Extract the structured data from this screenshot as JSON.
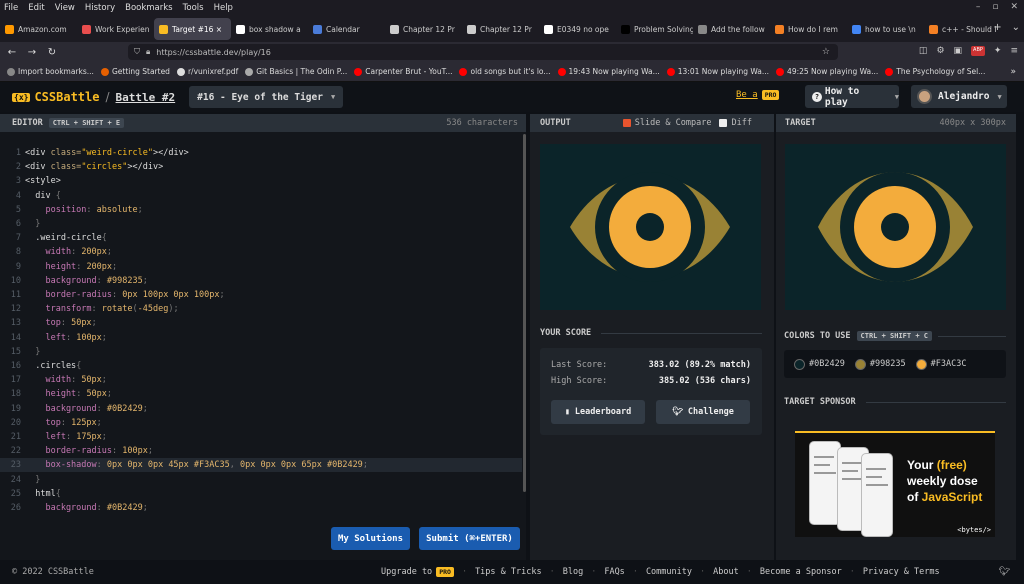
{
  "menubar": {
    "items": [
      "File",
      "Edit",
      "View",
      "History",
      "Bookmarks",
      "Tools",
      "Help"
    ]
  },
  "tabs": [
    {
      "label": "Amazon.com",
      "color": "#ff9900",
      "glyph": "a"
    },
    {
      "label": "Work Experien",
      "color": "#e94e4e",
      "glyph": "W"
    },
    {
      "label": "Target #16 ×",
      "color": "#f9bc23",
      "glyph": "C",
      "active": true
    },
    {
      "label": "box shadow a",
      "color": "#ffffff",
      "glyph": "/"
    },
    {
      "label": "Calendar",
      "color": "#4a7bd8",
      "glyph": "•"
    },
    {
      "label": "Chapter 12 Pr",
      "color": "#cccccc",
      "glyph": "□"
    },
    {
      "label": "Chapter 12 Pr",
      "color": "#cccccc",
      "glyph": "□"
    },
    {
      "label": "E0349 no ope",
      "color": "#ffffff",
      "glyph": "G"
    },
    {
      "label": "Problem Solving",
      "color": "#000000",
      "glyph": "■"
    },
    {
      "label": "Add the follow",
      "color": "#888888",
      "glyph": "◐"
    },
    {
      "label": "How do I rem",
      "color": "#f48024",
      "glyph": "S"
    },
    {
      "label": "how to use \\n",
      "color": "#4285f4",
      "glyph": "G"
    },
    {
      "label": "c++ - Should I",
      "color": "#f48024",
      "glyph": "S"
    }
  ],
  "url": "https://cssbattle.dev/play/16",
  "bookmarks": [
    {
      "label": "Import bookmarks...",
      "color": "#888888"
    },
    {
      "label": "Getting Started",
      "color": "#e66000"
    },
    {
      "label": "r/vunixref.pdf",
      "color": "#dddddd"
    },
    {
      "label": "Git Basics | The Odin P...",
      "color": "#aaaaaa"
    },
    {
      "label": "Carpenter Brut - YouT...",
      "color": "#ff0000"
    },
    {
      "label": "old songs but it's lo...",
      "color": "#ff0000"
    },
    {
      "label": "19:43 Now playing Wa...",
      "color": "#ff0000"
    },
    {
      "label": "13:01 Now playing Wa...",
      "color": "#ff0000"
    },
    {
      "label": "49:25 Now playing Wa...",
      "color": "#ff0000"
    },
    {
      "label": "The Psychology of Sel...",
      "color": "#ff0000"
    }
  ],
  "header": {
    "logo": "CSSBattle",
    "battle": "Battle #2",
    "level": "#16 - Eye of the Tiger",
    "be_a": "Be a",
    "pro": "PRO",
    "how_to_play": "How to play",
    "username": "Alejandro"
  },
  "editor": {
    "title": "EDITOR",
    "shortcut": "CTRL + SHIFT + E",
    "char_count": "536 characters",
    "highlighted_line": 23,
    "lines": [
      [
        [
          "c-tag",
          "<div "
        ],
        [
          "c-attr",
          "class="
        ],
        [
          "c-str",
          "\"weird-circle\""
        ],
        [
          "c-tag",
          "></div>"
        ]
      ],
      [
        [
          "c-tag",
          "<div "
        ],
        [
          "c-attr",
          "class="
        ],
        [
          "c-str",
          "\"circles\""
        ],
        [
          "c-tag",
          "></div>"
        ]
      ],
      [
        [
          "c-tag",
          "<style>"
        ]
      ],
      [
        [
          "c-sel",
          "  div "
        ],
        [
          "c-pun",
          "{"
        ]
      ],
      [
        [
          "c-prop",
          "    position"
        ],
        [
          "c-pun",
          ": "
        ],
        [
          "c-val",
          "absolute"
        ],
        [
          "c-pun",
          ";"
        ]
      ],
      [
        [
          "c-pun",
          "  }"
        ]
      ],
      [
        [
          "c-sel",
          "  .weird-circle"
        ],
        [
          "c-pun",
          "{"
        ]
      ],
      [
        [
          "c-prop",
          "    width"
        ],
        [
          "c-pun",
          ": "
        ],
        [
          "c-val",
          "200px"
        ],
        [
          "c-pun",
          ";"
        ]
      ],
      [
        [
          "c-prop",
          "    height"
        ],
        [
          "c-pun",
          ": "
        ],
        [
          "c-val",
          "200px"
        ],
        [
          "c-pun",
          ";"
        ]
      ],
      [
        [
          "c-prop",
          "    background"
        ],
        [
          "c-pun",
          ": "
        ],
        [
          "c-val",
          "#998235"
        ],
        [
          "c-pun",
          ";"
        ]
      ],
      [
        [
          "c-prop",
          "    border-radius"
        ],
        [
          "c-pun",
          ": "
        ],
        [
          "c-val",
          "0px 100px 0px 100px"
        ],
        [
          "c-pun",
          ";"
        ]
      ],
      [
        [
          "c-prop",
          "    transform"
        ],
        [
          "c-pun",
          ": "
        ],
        [
          "c-val",
          "rotate"
        ],
        [
          "c-pun",
          "("
        ],
        [
          "c-val",
          "-45deg"
        ],
        [
          "c-pun",
          ");"
        ]
      ],
      [
        [
          "c-prop",
          "    top"
        ],
        [
          "c-pun",
          ": "
        ],
        [
          "c-val",
          "50px"
        ],
        [
          "c-pun",
          ";"
        ]
      ],
      [
        [
          "c-prop",
          "    left"
        ],
        [
          "c-pun",
          ": "
        ],
        [
          "c-val",
          "100px"
        ],
        [
          "c-pun",
          ";"
        ]
      ],
      [
        [
          "c-pun",
          "  }"
        ]
      ],
      [
        [
          "c-sel",
          "  .circles"
        ],
        [
          "c-pun",
          "{"
        ]
      ],
      [
        [
          "c-prop",
          "    width"
        ],
        [
          "c-pun",
          ": "
        ],
        [
          "c-val",
          "50px"
        ],
        [
          "c-pun",
          ";"
        ]
      ],
      [
        [
          "c-prop",
          "    height"
        ],
        [
          "c-pun",
          ": "
        ],
        [
          "c-val",
          "50px"
        ],
        [
          "c-pun",
          ";"
        ]
      ],
      [
        [
          "c-prop",
          "    background"
        ],
        [
          "c-pun",
          ": "
        ],
        [
          "c-val",
          "#0B2429"
        ],
        [
          "c-pun",
          ";"
        ]
      ],
      [
        [
          "c-prop",
          "    top"
        ],
        [
          "c-pun",
          ": "
        ],
        [
          "c-val",
          "125px"
        ],
        [
          "c-pun",
          ";"
        ]
      ],
      [
        [
          "c-prop",
          "    left"
        ],
        [
          "c-pun",
          ": "
        ],
        [
          "c-val",
          "175px"
        ],
        [
          "c-pun",
          ";"
        ]
      ],
      [
        [
          "c-prop",
          "    border-radius"
        ],
        [
          "c-pun",
          ": "
        ],
        [
          "c-val",
          "100px"
        ],
        [
          "c-pun",
          ";"
        ]
      ],
      [
        [
          "c-prop",
          "    box-shadow"
        ],
        [
          "c-pun",
          ": "
        ],
        [
          "c-val",
          "0px 0px 0px 45px #F3AC35"
        ],
        [
          "c-pun",
          ", "
        ],
        [
          "c-val",
          "0px 0px 0px 65px #0B2429"
        ],
        [
          "c-pun",
          ";"
        ]
      ],
      [
        [
          "c-pun",
          "  }"
        ]
      ],
      [
        [
          "c-sel",
          "  html"
        ],
        [
          "c-pun",
          "{"
        ]
      ],
      [
        [
          "c-prop",
          "    background"
        ],
        [
          "c-pun",
          ": "
        ],
        [
          "c-val",
          "#0B2429"
        ],
        [
          "c-pun",
          ";"
        ]
      ]
    ],
    "my_solutions": "My Solutions",
    "submit": "Submit (⌘+ENTER)"
  },
  "output": {
    "title": "OUTPUT",
    "slide_compare": "Slide & Compare",
    "diff": "Diff"
  },
  "target": {
    "title": "TARGET",
    "dims": "400px x 300px"
  },
  "score": {
    "title": "YOUR SCORE",
    "last_label": "Last Score:",
    "last_value": "383.02 (89.2% match)",
    "high_label": "High Score:",
    "high_value": "385.02 (536 chars)",
    "leaderboard": "Leaderboard",
    "challenge": "Challenge"
  },
  "colors": {
    "title": "COLORS TO USE",
    "shortcut": "CTRL + SHIFT + C",
    "swatches": [
      {
        "hex": "#0B2429"
      },
      {
        "hex": "#998235"
      },
      {
        "hex": "#F3AC3C"
      }
    ]
  },
  "sponsor": {
    "title": "TARGET SPONSOR",
    "line1": "Your",
    "free": "(free)",
    "line2": "weekly dose",
    "of": "of",
    "js": "JavaScript",
    "brand": "<bytes/>"
  },
  "footer": {
    "copyright": "© 2022 CSSBattle",
    "links": [
      "Upgrade to",
      "Tips & Tricks",
      "Blog",
      "FAQs",
      "Community",
      "About",
      "Become a Sponsor",
      "Privacy & Terms"
    ],
    "pro": "PRO"
  }
}
